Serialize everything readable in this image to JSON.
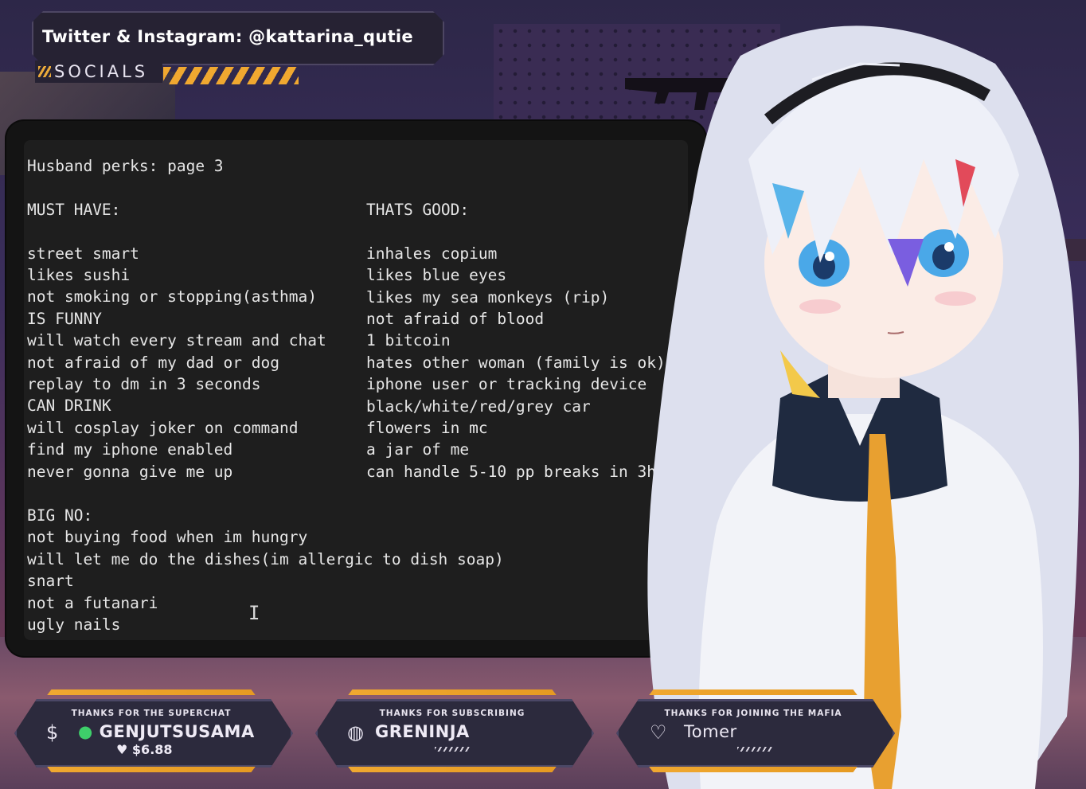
{
  "socials": {
    "handle": "Twitter & Instagram: @kattarina_qutie",
    "label": "SOCIALS"
  },
  "notepad": {
    "title": "Husband perks: page 3",
    "must_have_header": "MUST HAVE:",
    "must_have": [
      "street smart",
      "likes sushi",
      "not smoking or stopping(asthma)",
      "IS FUNNY",
      "will watch every stream and chat",
      "not afraid of my dad or dog",
      "replay to dm in 3 seconds",
      "CAN DRINK",
      "will cosplay joker on command",
      "find my iphone enabled",
      "never gonna give me up"
    ],
    "thats_good_header": "THATS GOOD:",
    "thats_good": [
      "inhales copium",
      "likes blue eyes",
      "likes my sea monkeys (rip)",
      "not afraid of blood",
      "1 bitcoin",
      "hates other woman (family is ok)",
      "iphone user or tracking device",
      "black/white/red/grey car",
      "flowers in mc",
      "a jar of me",
      "can handle 5-10 pp breaks in 3h"
    ],
    "big_no_header": "BIG NO:",
    "big_no": [
      "not buying food when im hungry",
      "will let me do the dishes(im allergic to dish soap)",
      "snart",
      "not a futanari",
      "ugly nails"
    ],
    "cursor_glyph": "I"
  },
  "alerts": [
    {
      "caption": "THANKS FOR THE SUPERCHAT",
      "name": "GENJUTSUSAMA",
      "amount": "$6.88",
      "icon": "dollar-icon"
    },
    {
      "caption": "THANKS FOR SUBSCRIBING",
      "name": "GRENINJA",
      "icon": "globe-icon"
    },
    {
      "caption": "THANKS FOR JOINING THE MAFIA",
      "name": "Tomer",
      "icon": "heart-icon"
    }
  ],
  "colors": {
    "accent_orange": "#f0a830",
    "panel_bg": "#1e1e1e",
    "card_bg": "#2c2a3d",
    "hair_white": "#eef0f8",
    "eye_blue": "#4aa8e8",
    "tie_orange": "#e8a030"
  }
}
